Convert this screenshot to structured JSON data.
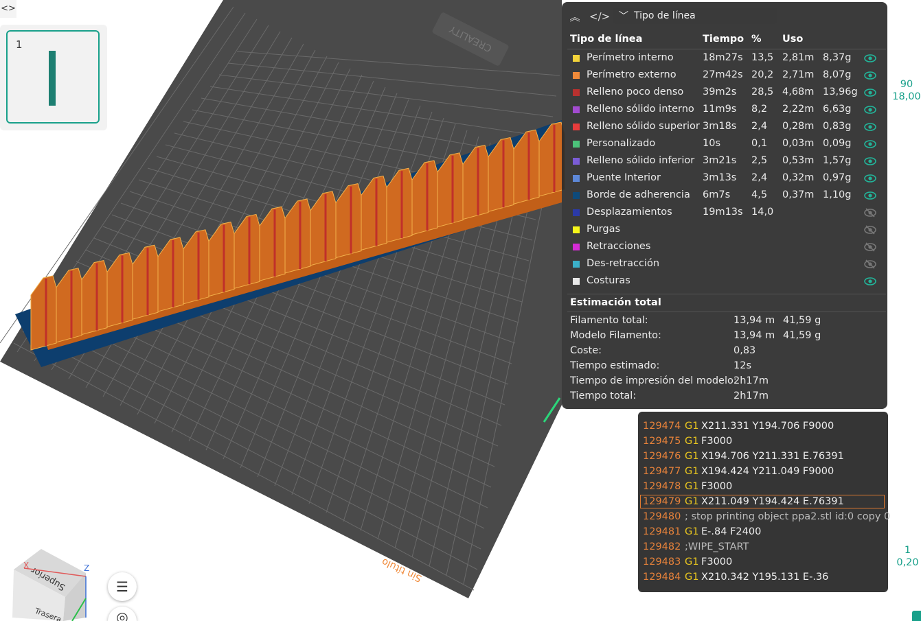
{
  "toolbar": {
    "code_toggle_icon": "code-toggle-icon",
    "plate_number": "1"
  },
  "legend": {
    "collapse_icon": "collapse-icon",
    "code_icon": "code-icon",
    "view_select": "Tipo de línea",
    "headers": {
      "type": "Tipo de línea",
      "time": "Tiempo",
      "pct": "%",
      "usage": "Uso"
    },
    "rows": [
      {
        "label": "Perímetro interno",
        "time": "18m27s",
        "pct": "13,5",
        "len": "2,81m",
        "wt": "8,37g",
        "color": "#f2d33a",
        "visible": true
      },
      {
        "label": "Perímetro externo",
        "time": "27m42s",
        "pct": "20,2",
        "len": "2,71m",
        "wt": "8,07g",
        "color": "#f08a3a",
        "visible": true
      },
      {
        "label": "Relleno poco denso",
        "time": "39m2s",
        "pct": "28,5",
        "len": "4,68m",
        "wt": "13,96g",
        "color": "#b8312f",
        "visible": true
      },
      {
        "label": "Relleno sólido interno",
        "time": "11m9s",
        "pct": "8,2",
        "len": "2,22m",
        "wt": "6,63g",
        "color": "#a24bd0",
        "visible": true
      },
      {
        "label": "Relleno sólido superior",
        "time": "3m18s",
        "pct": "2,4",
        "len": "0,28m",
        "wt": "0,83g",
        "color": "#e83c3c",
        "visible": true
      },
      {
        "label": "Personalizado",
        "time": "10s",
        "pct": "0,1",
        "len": "0,03m",
        "wt": "0,09g",
        "color": "#4cc27a",
        "visible": true
      },
      {
        "label": "Relleno sólido inferior",
        "time": "3m21s",
        "pct": "2,5",
        "len": "0,53m",
        "wt": "1,57g",
        "color": "#7a5cd6",
        "visible": true
      },
      {
        "label": "Puente Interior",
        "time": "3m13s",
        "pct": "2,4",
        "len": "0,32m",
        "wt": "0,97g",
        "color": "#5d88d8",
        "visible": true
      },
      {
        "label": "Borde de adherencia",
        "time": "6m7s",
        "pct": "4,5",
        "len": "0,37m",
        "wt": "1,10g",
        "color": "#0e4a7a",
        "visible": true
      },
      {
        "label": "Desplazamientos",
        "time": "19m13s",
        "pct": "14,0",
        "len": "",
        "wt": "",
        "color": "#2b3aa8",
        "visible": false
      },
      {
        "label": "Purgas",
        "time": "",
        "pct": "",
        "len": "",
        "wt": "",
        "color": "#f5f51a",
        "visible": false
      },
      {
        "label": "Retracciones",
        "time": "",
        "pct": "",
        "len": "",
        "wt": "",
        "color": "#d42bd4",
        "visible": false
      },
      {
        "label": "Des-retracción",
        "time": "",
        "pct": "",
        "len": "",
        "wt": "",
        "color": "#3bb0c9",
        "visible": false
      },
      {
        "label": "Costuras",
        "time": "",
        "pct": "",
        "len": "",
        "wt": "",
        "color": "#e8e8e8",
        "visible": true
      }
    ],
    "estimate_title": "Estimación total",
    "estimates": [
      {
        "label": "Filamento total:",
        "v1": "13,94 m",
        "v2": "41,59 g"
      },
      {
        "label": "Modelo Filamento:",
        "v1": "13,94 m",
        "v2": "41,59 g"
      },
      {
        "label": "Coste:",
        "v1": "0,83",
        "v2": ""
      },
      {
        "label": "Tiempo estimado:",
        "v1": "12s",
        "v2": ""
      },
      {
        "label": "Tiempo de impresión del modelo:",
        "v1": "2h17m",
        "v2": ""
      },
      {
        "label": "Tiempo total:",
        "v1": "2h17m",
        "v2": ""
      }
    ]
  },
  "gcode": {
    "lines": [
      {
        "n": "129474",
        "cmd": "G1",
        "args": "X211.331 Y194.706 F9000",
        "comment": ""
      },
      {
        "n": "129475",
        "cmd": "G1",
        "args": "F3000",
        "comment": ""
      },
      {
        "n": "129476",
        "cmd": "G1",
        "args": "X194.706 Y211.331 E.76391",
        "comment": ""
      },
      {
        "n": "129477",
        "cmd": "G1",
        "args": "X194.424 Y211.049 F9000",
        "comment": ""
      },
      {
        "n": "129478",
        "cmd": "G1",
        "args": "F3000",
        "comment": ""
      },
      {
        "n": "129479",
        "cmd": "G1",
        "args": "X211.049 Y194.424 E.76391",
        "comment": "",
        "highlight": true
      },
      {
        "n": "129480",
        "cmd": "",
        "args": "",
        "comment": "; stop printing object ppa2.stl id:0 copy 0"
      },
      {
        "n": "129481",
        "cmd": "G1",
        "args": "E-.84 F2400",
        "comment": ""
      },
      {
        "n": "129482",
        "cmd": "",
        "args": "",
        "comment": ";WIPE_START"
      },
      {
        "n": "129483",
        "cmd": "G1",
        "args": "F3000",
        "comment": ""
      },
      {
        "n": "129484",
        "cmd": "G1",
        "args": "X210.342 Y195.131 E-.36",
        "comment": ""
      }
    ]
  },
  "slider": {
    "top_layer": "90",
    "top_height": "18,00",
    "bottom_layer": "1",
    "bottom_height": "0,20"
  },
  "scene": {
    "bed_brand": "CREALITY",
    "plate_name": "Sin título",
    "cube_face_top": "Superior",
    "cube_face_side": "Trasera",
    "axis_z": "Z",
    "axis_x": "X",
    "menu_icon": "menu-icon",
    "rotate_icon": "rotate-icon"
  }
}
